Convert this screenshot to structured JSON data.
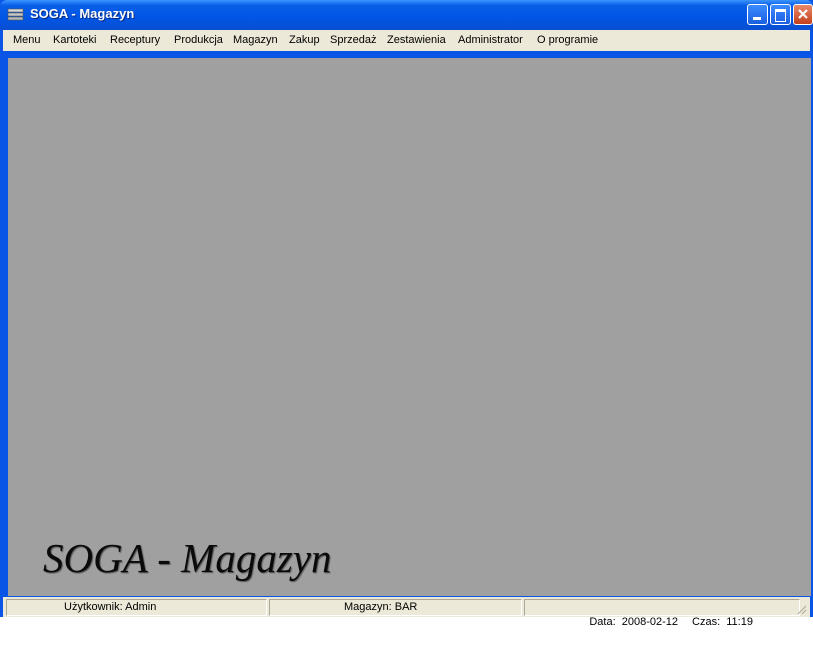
{
  "window": {
    "title": "SOGA - Magazyn",
    "controls": {
      "minimize": "minimize",
      "maximize": "maximize",
      "close": "close"
    }
  },
  "menu": {
    "items": [
      "Menu",
      "Kartoteki",
      "Receptury",
      "Produkcja",
      "Magazyn",
      "Zakup",
      "Sprzedaż",
      "Zestawienia",
      "Administrator",
      "O programie"
    ]
  },
  "workspace": {
    "logo_text": "SOGA - Magazyn"
  },
  "status": {
    "user": "Użytkownik: Admin",
    "warehouse": "Magazyn: BAR",
    "date": "Data:  2008-02-12",
    "time": "Czas:  11:19"
  },
  "colors": {
    "titlebar": "#0055e5",
    "workspace": "#a0a0a0",
    "menubar": "#ece9d8"
  }
}
